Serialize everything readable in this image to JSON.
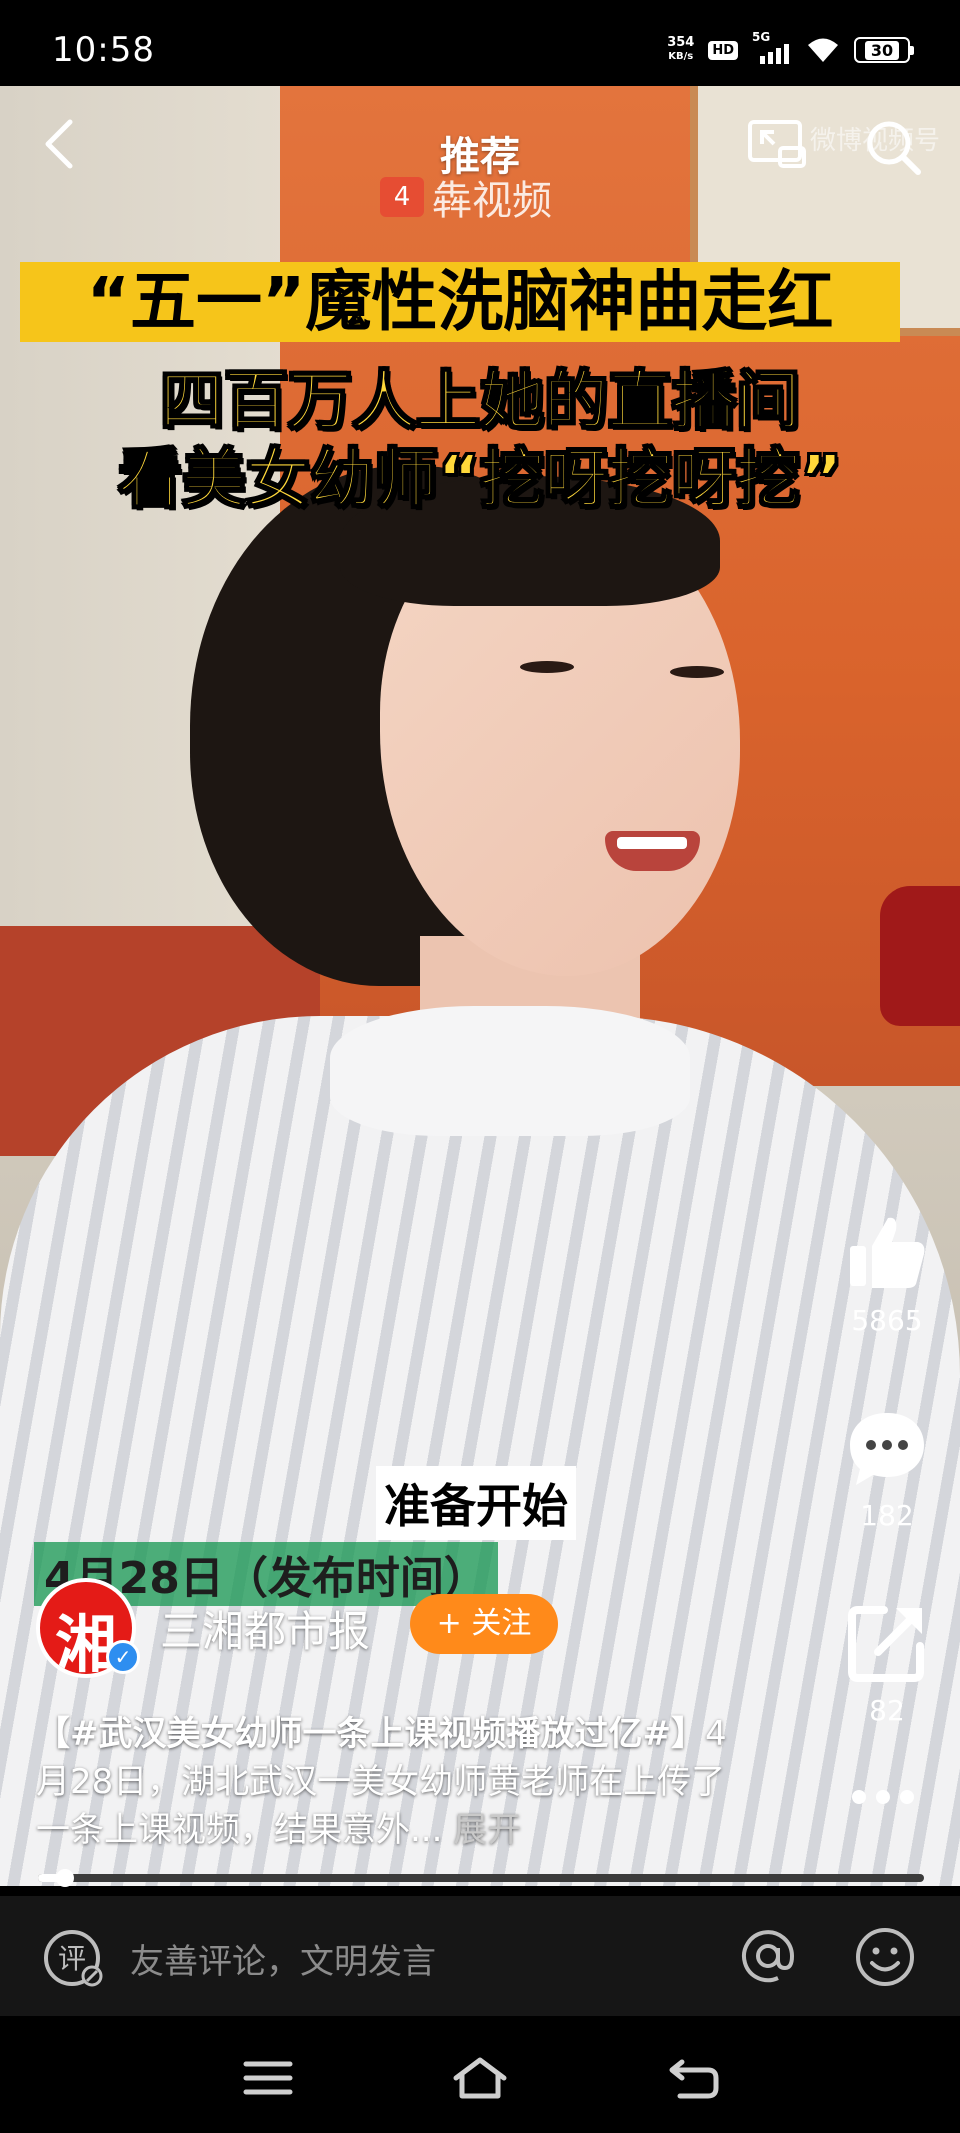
{
  "status_bar": {
    "time": "10:58",
    "net_speed_value": "354",
    "net_speed_unit": "KB/s",
    "hd": "HD",
    "network": "5G",
    "battery": "30"
  },
  "top_nav": {
    "title": "推荐"
  },
  "video": {
    "watermark_logo": "犇视频",
    "watermark_logo_mark": "4",
    "watermark_right": "微博视频号",
    "headline_1": "“五一”魔性洗脑神曲走红",
    "headline_2": "四百万人上她的直播间",
    "headline_3": "看美女幼师“挖呀挖呀挖”",
    "subtitle": "准备开始",
    "date_caption": "4月28日（发布时间）",
    "progress_fraction": 0.03
  },
  "actions": {
    "like_count": "5865",
    "comment_count": "182",
    "share_count": "82"
  },
  "account": {
    "avatar_text": "湘",
    "name": "三湘都市报",
    "follow_label": "+ 关注"
  },
  "description": {
    "hashtag": "【#武汉美女幼师一条上课视频播放过亿#】",
    "text": "4月28日，湖北武汉一美女幼师黄老师在上传了一条上课视频，结果意外...",
    "expand_label": "展开"
  },
  "comment_bar": {
    "placeholder": "友善评论，文明发言"
  },
  "icons": {
    "back": "back-arrow-icon",
    "pip": "picture-in-picture-icon",
    "search": "search-icon",
    "like": "thumbs-up-icon",
    "comment": "chat-bubble-icon",
    "share": "share-icon",
    "more": "more-dots-icon",
    "comment_input": "comment-pen-icon",
    "at": "at-sign-icon",
    "emoji": "smiley-icon",
    "menu": "menu-icon",
    "home": "home-icon",
    "back_nav": "return-icon"
  },
  "colors": {
    "follow_button": "#ff8a1a",
    "headline_banner": "#f6c51a",
    "headline_text": "#ffd83a",
    "verified": "#2e8ef0"
  }
}
